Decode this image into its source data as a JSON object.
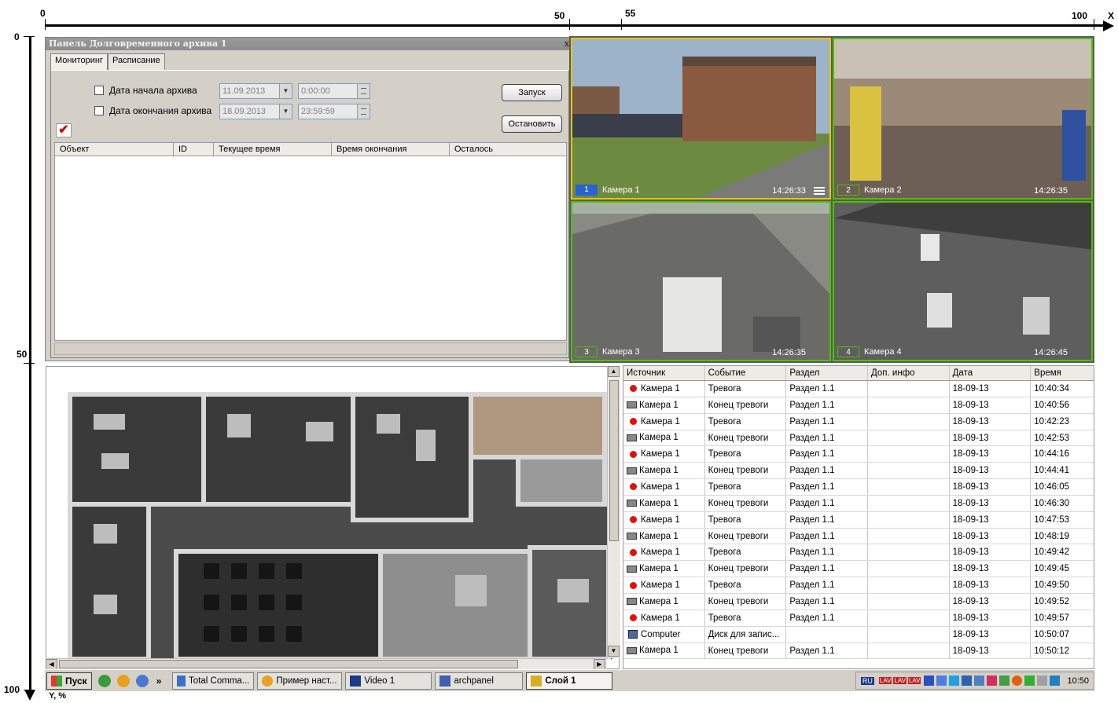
{
  "axes": {
    "x_ticks": [
      "0",
      "50",
      "55",
      "100"
    ],
    "x_name": "X",
    "y_ticks": [
      "0",
      "50",
      "100"
    ],
    "y_name": "Y, %"
  },
  "archive_panel": {
    "title": "Панель Долговременного архива 1",
    "close": "x",
    "tabs": [
      "Мониторинг",
      "Расписание"
    ],
    "start_label": "Дата начала архива",
    "start_date": "11.09.2013",
    "start_time": "0:00:00",
    "end_label": "Дата окончания архива",
    "end_date": "18.09.2013",
    "end_time": "23:59:59",
    "run_button": "Запуск",
    "stop_button": "Остановить",
    "columns": [
      "Объект",
      "ID",
      "Текущее время",
      "Время окончания",
      "Осталось"
    ]
  },
  "cameras": [
    {
      "num": "1",
      "name": "Камера 1",
      "time": "14:26:33"
    },
    {
      "num": "2",
      "name": "Камера 2",
      "time": "14:26:35"
    },
    {
      "num": "3",
      "name": "Камера 3",
      "time": "14:26:35"
    },
    {
      "num": "4",
      "name": "Камера 4",
      "time": "14:26:45"
    }
  ],
  "events": {
    "columns": [
      "Источник",
      "Событие",
      "Раздел",
      "Доп. инфо",
      "Дата",
      "Время"
    ],
    "rows": [
      {
        "icon": "alarm",
        "source": "Камера 1",
        "event": "Тревога",
        "section": "Раздел 1.1",
        "info": "",
        "date": "18-09-13",
        "time": "10:40:34"
      },
      {
        "icon": "camera",
        "source": "Камера 1",
        "event": "Конец тревоги",
        "section": "Раздел 1.1",
        "info": "",
        "date": "18-09-13",
        "time": "10:40:56"
      },
      {
        "icon": "alarm",
        "source": "Камера 1",
        "event": "Тревога",
        "section": "Раздел 1.1",
        "info": "",
        "date": "18-09-13",
        "time": "10:42:23"
      },
      {
        "icon": "camera",
        "source": "Камера 1",
        "event": "Конец тревоги",
        "section": "Раздел 1.1",
        "info": "",
        "date": "18-09-13",
        "time": "10:42:53"
      },
      {
        "icon": "alarm",
        "source": "Камера 1",
        "event": "Тревога",
        "section": "Раздел 1.1",
        "info": "",
        "date": "18-09-13",
        "time": "10:44:16"
      },
      {
        "icon": "camera",
        "source": "Камера 1",
        "event": "Конец тревоги",
        "section": "Раздел 1.1",
        "info": "",
        "date": "18-09-13",
        "time": "10:44:41"
      },
      {
        "icon": "alarm",
        "source": "Камера 1",
        "event": "Тревога",
        "section": "Раздел 1.1",
        "info": "",
        "date": "18-09-13",
        "time": "10:46:05"
      },
      {
        "icon": "camera",
        "source": "Камера 1",
        "event": "Конец тревоги",
        "section": "Раздел 1.1",
        "info": "",
        "date": "18-09-13",
        "time": "10:46:30"
      },
      {
        "icon": "alarm",
        "source": "Камера 1",
        "event": "Тревога",
        "section": "Раздел 1.1",
        "info": "",
        "date": "18-09-13",
        "time": "10:47:53"
      },
      {
        "icon": "camera",
        "source": "Камера 1",
        "event": "Конец тревоги",
        "section": "Раздел 1.1",
        "info": "",
        "date": "18-09-13",
        "time": "10:48:19"
      },
      {
        "icon": "alarm",
        "source": "Камера 1",
        "event": "Тревога",
        "section": "Раздел 1.1",
        "info": "",
        "date": "18-09-13",
        "time": "10:49:42"
      },
      {
        "icon": "camera",
        "source": "Камера 1",
        "event": "Конец тревоги",
        "section": "Раздел 1.1",
        "info": "",
        "date": "18-09-13",
        "time": "10:49:45"
      },
      {
        "icon": "alarm",
        "source": "Камера 1",
        "event": "Тревога",
        "section": "Раздел 1.1",
        "info": "",
        "date": "18-09-13",
        "time": "10:49:50"
      },
      {
        "icon": "camera",
        "source": "Камера 1",
        "event": "Конец тревоги",
        "section": "Раздел 1.1",
        "info": "",
        "date": "18-09-13",
        "time": "10:49:52"
      },
      {
        "icon": "alarm",
        "source": "Камера 1",
        "event": "Тревога",
        "section": "Раздел 1.1",
        "info": "",
        "date": "18-09-13",
        "time": "10:49:57"
      },
      {
        "icon": "computer",
        "source": "Computer",
        "event": "Диск для запис...",
        "section": "",
        "info": "",
        "date": "18-09-13",
        "time": "10:50:07"
      },
      {
        "icon": "camera",
        "source": "Камера 1",
        "event": "Конец тревоги",
        "section": "Раздел 1.1",
        "info": "",
        "date": "18-09-13",
        "time": "10:50:12"
      }
    ]
  },
  "taskbar": {
    "start": "Пуск",
    "more": "»",
    "buttons": [
      "Total Comma...",
      "Пример наст...",
      "Video 1",
      "archpanel",
      "Слой 1"
    ],
    "tray_lang": "RU",
    "tray_badge": "LAV",
    "clock": "10:50"
  },
  "colors": {
    "alarm": "#e01010",
    "cam_border": "#4ec000",
    "cam_selected": "#e8c600",
    "cam_number": "#2a62d0"
  }
}
